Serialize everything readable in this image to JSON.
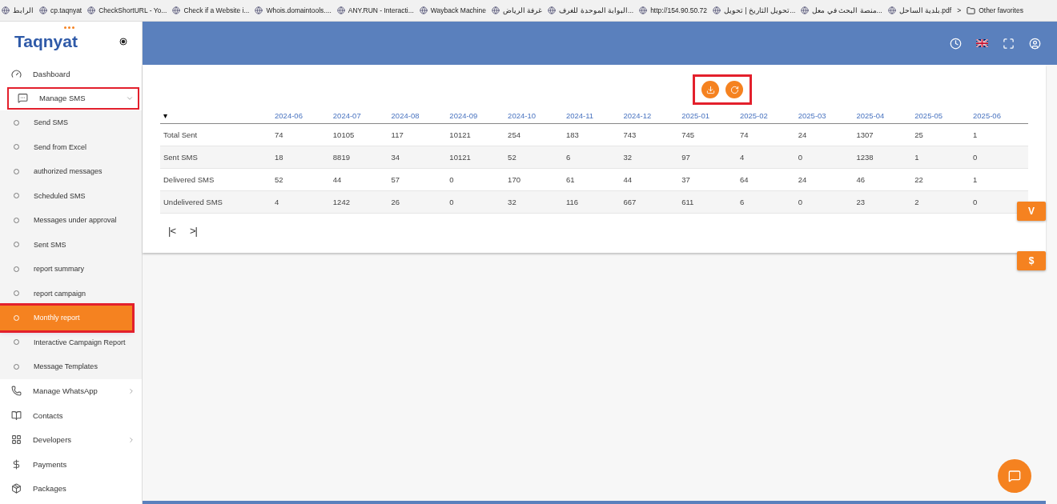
{
  "bookmarks": [
    {
      "label": "الرابط"
    },
    {
      "label": "cp.taqnyat"
    },
    {
      "label": "CheckShortURL - Yo..."
    },
    {
      "label": "Check if a Website i..."
    },
    {
      "label": "Whois.domaintools...."
    },
    {
      "label": "ANY.RUN - Interacti..."
    },
    {
      "label": "Wayback Machine"
    },
    {
      "label": "غرفة الرياض"
    },
    {
      "label": "البوابة الموحدة للغرف..."
    },
    {
      "label": "http://154.90.50.72"
    },
    {
      "label": "تحويل التاريخ | تحويل..."
    },
    {
      "label": "منصة البحث في معل..."
    },
    {
      "label": "بلدية الساحل.pdf"
    }
  ],
  "more_bookmarks": ">",
  "other_favorites": "Other favorites",
  "logo": "Taqnyat",
  "sidebar": [
    {
      "label": "Dashboard",
      "selected": false,
      "highlighted": false,
      "expandable": false
    },
    {
      "label": "Manage SMS",
      "selected": false,
      "highlighted": true,
      "expandable": true,
      "children": [
        {
          "label": "Send SMS",
          "selected": false,
          "highlighted": false
        },
        {
          "label": "Send from Excel",
          "selected": false,
          "highlighted": false
        },
        {
          "label": "authorized messages",
          "selected": false,
          "highlighted": false
        },
        {
          "label": "Scheduled SMS",
          "selected": false,
          "highlighted": false
        },
        {
          "label": "Messages under approval",
          "selected": false,
          "highlighted": false
        },
        {
          "label": "Sent SMS",
          "selected": false,
          "highlighted": false
        },
        {
          "label": "report summary",
          "selected": false,
          "highlighted": false
        },
        {
          "label": "report campaign",
          "selected": false,
          "highlighted": false
        },
        {
          "label": "Monthly report",
          "selected": true,
          "highlighted": true
        },
        {
          "label": "Interactive Campaign Report",
          "selected": false,
          "highlighted": false
        },
        {
          "label": "Message Templates",
          "selected": false,
          "highlighted": false
        }
      ]
    },
    {
      "label": "Manage WhatsApp",
      "selected": false,
      "highlighted": false,
      "expandable": true
    },
    {
      "label": "Contacts",
      "selected": false,
      "highlighted": false,
      "expandable": false
    },
    {
      "label": "Developers",
      "selected": false,
      "highlighted": false,
      "expandable": true
    },
    {
      "label": "Payments",
      "selected": false,
      "highlighted": false,
      "expandable": false
    },
    {
      "label": "Packages",
      "selected": false,
      "highlighted": false,
      "expandable": false
    }
  ],
  "toolbar": {
    "highlighted": true
  },
  "table": {
    "menu": "▾",
    "columns": [
      "2024-06",
      "2024-07",
      "2024-08",
      "2024-09",
      "2024-10",
      "2024-11",
      "2024-12",
      "2025-01",
      "2025-02",
      "2025-03",
      "2025-04",
      "2025-05",
      "2025-06"
    ],
    "rows": [
      {
        "label": "Total Sent",
        "cells": [
          "74",
          "10105",
          "117",
          "10121",
          "254",
          "183",
          "743",
          "745",
          "74",
          "24",
          "1307",
          "25",
          "1"
        ]
      },
      {
        "label": "Sent SMS",
        "cells": [
          "18",
          "8819",
          "34",
          "10121",
          "52",
          "6",
          "32",
          "97",
          "4",
          "0",
          "1238",
          "1",
          "0"
        ]
      },
      {
        "label": "Delivered SMS",
        "cells": [
          "52",
          "44",
          "57",
          "0",
          "170",
          "61",
          "44",
          "37",
          "64",
          "24",
          "46",
          "22",
          "1"
        ]
      },
      {
        "label": "Undelivered SMS",
        "cells": [
          "4",
          "1242",
          "26",
          "0",
          "32",
          "116",
          "667",
          "611",
          "6",
          "0",
          "23",
          "2",
          "0"
        ]
      }
    ]
  },
  "pager": {
    "prev": "|<",
    "next": ">|"
  },
  "side_tabs": [
    "V",
    "$"
  ]
}
